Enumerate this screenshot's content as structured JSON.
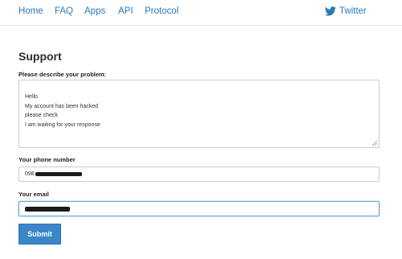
{
  "nav": {
    "items": [
      {
        "label": "Home"
      },
      {
        "label": "FAQ"
      },
      {
        "label": "Apps"
      },
      {
        "label": "API"
      },
      {
        "label": "Protocol"
      }
    ],
    "twitter_label": "Twitter"
  },
  "form": {
    "title": "Support",
    "problem_label": "Please describe your problem:",
    "message_lines": [
      "Hello",
      "My account has been hacked",
      "please check",
      "I am waiting for your response"
    ],
    "phone_label": "Your phone number",
    "phone_value_visible": "098",
    "email_label": "Your email",
    "submit_label": "Submit"
  },
  "colors": {
    "link": "#2a7ab8",
    "button": "#3a86c8",
    "focus_border": "#66a5d6"
  },
  "icons": {
    "twitter": "twitter-bird-icon"
  }
}
